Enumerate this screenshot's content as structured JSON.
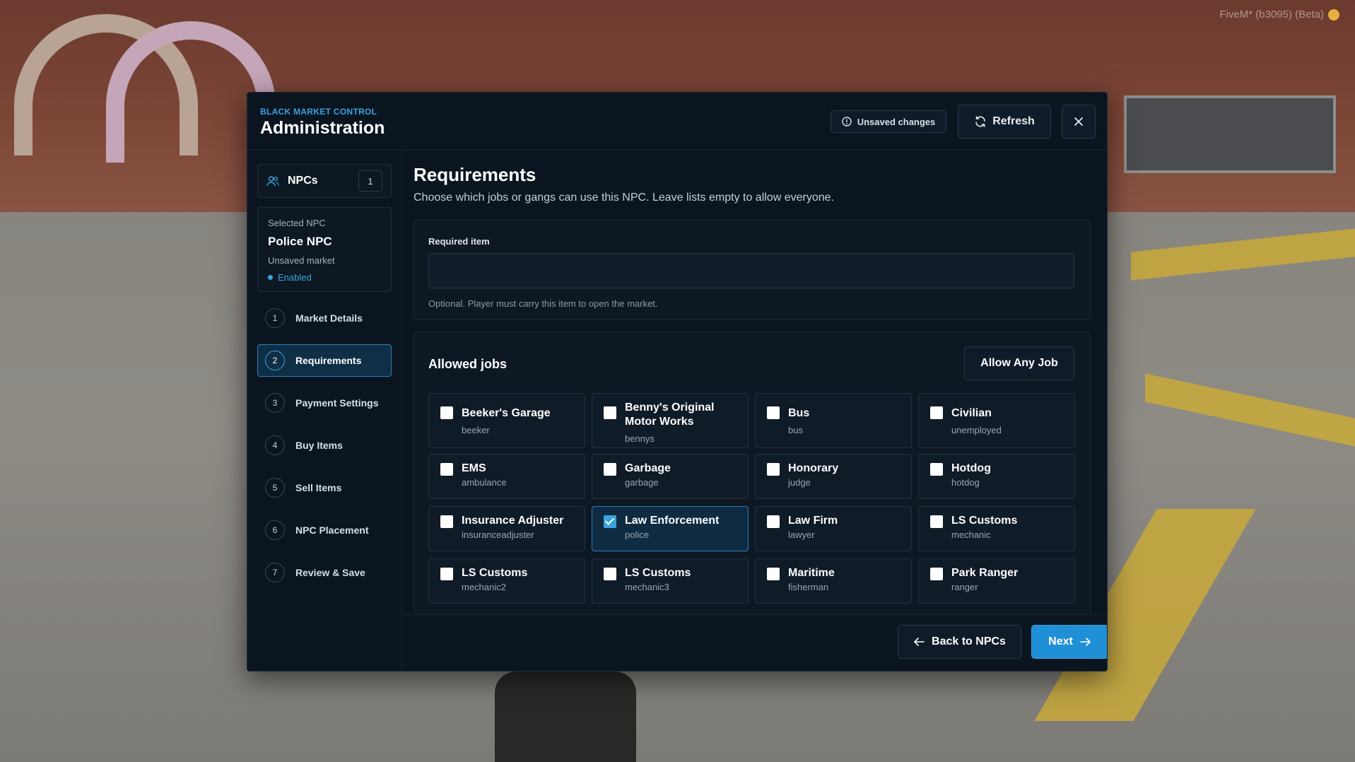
{
  "overlay": {
    "fivem_label": "FiveM* (b3095) (Beta)"
  },
  "header": {
    "kicker": "BLACK MARKET CONTROL",
    "title": "Administration",
    "unsaved_label": "Unsaved changes",
    "refresh_label": "Refresh"
  },
  "sidebar": {
    "npcs_label": "NPCs",
    "npcs_count": "1",
    "selected": {
      "kicker": "Selected NPC",
      "name": "Police NPC",
      "market": "Unsaved market",
      "status": "Enabled"
    },
    "steps": [
      {
        "num": "1",
        "label": "Market Details"
      },
      {
        "num": "2",
        "label": "Requirements"
      },
      {
        "num": "3",
        "label": "Payment Settings"
      },
      {
        "num": "4",
        "label": "Buy Items"
      },
      {
        "num": "5",
        "label": "Sell Items"
      },
      {
        "num": "6",
        "label": "NPC Placement"
      },
      {
        "num": "7",
        "label": "Review & Save"
      }
    ],
    "active_step": 2
  },
  "main": {
    "title": "Requirements",
    "description": "Choose which jobs or gangs can use this NPC. Leave lists empty to allow everyone.",
    "required_item": {
      "label": "Required item",
      "value": "",
      "hint": "Optional. Player must carry this item to open the market."
    },
    "jobs": {
      "title": "Allowed jobs",
      "allow_any_label": "Allow Any Job",
      "items": [
        {
          "name": "Beeker's Garage",
          "id": "beeker",
          "checked": false
        },
        {
          "name": "Benny's Original Motor Works",
          "id": "bennys",
          "checked": false
        },
        {
          "name": "Bus",
          "id": "bus",
          "checked": false
        },
        {
          "name": "Civilian",
          "id": "unemployed",
          "checked": false
        },
        {
          "name": "EMS",
          "id": "ambulance",
          "checked": false
        },
        {
          "name": "Garbage",
          "id": "garbage",
          "checked": false
        },
        {
          "name": "Honorary",
          "id": "judge",
          "checked": false
        },
        {
          "name": "Hotdog",
          "id": "hotdog",
          "checked": false
        },
        {
          "name": "Insurance Adjuster",
          "id": "insuranceadjuster",
          "checked": false
        },
        {
          "name": "Law Enforcement",
          "id": "police",
          "checked": true
        },
        {
          "name": "Law Firm",
          "id": "lawyer",
          "checked": false
        },
        {
          "name": "LS Customs",
          "id": "mechanic",
          "checked": false
        },
        {
          "name": "LS Customs",
          "id": "mechanic2",
          "checked": false
        },
        {
          "name": "LS Customs",
          "id": "mechanic3",
          "checked": false
        },
        {
          "name": "Maritime",
          "id": "fisherman",
          "checked": false
        },
        {
          "name": "Park Ranger",
          "id": "ranger",
          "checked": false
        }
      ]
    }
  },
  "footer": {
    "back_label": "Back to NPCs",
    "next_label": "Next"
  },
  "colors": {
    "accent": "#3aa3e0",
    "panel": "#0b1520",
    "active_bg": "#0f2f47"
  }
}
